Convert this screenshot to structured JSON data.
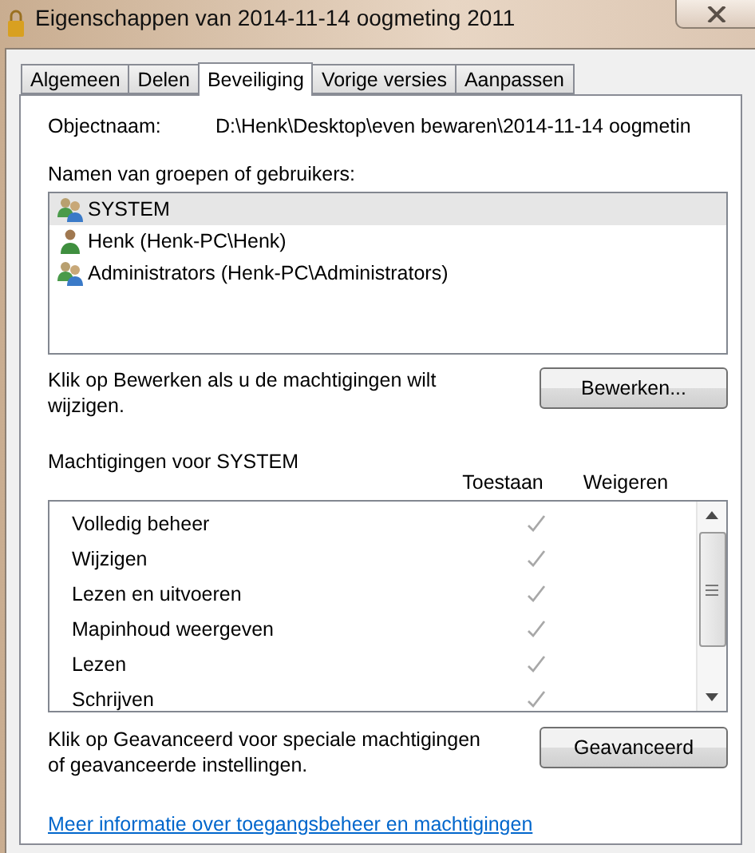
{
  "window": {
    "title": "Eigenschappen van 2014-11-14 oogmeting 2011"
  },
  "tabs": [
    {
      "label": "Algemeen",
      "selected": false
    },
    {
      "label": "Delen",
      "selected": false
    },
    {
      "label": "Beveiliging",
      "selected": true
    },
    {
      "label": "Vorige versies",
      "selected": false
    },
    {
      "label": "Aanpassen",
      "selected": false
    }
  ],
  "object": {
    "label": "Objectnaam:",
    "value": "D:\\Henk\\Desktop\\even bewaren\\2014-11-14 oogmetin"
  },
  "users": {
    "label": "Namen van groepen of gebruikers:",
    "items": [
      {
        "name": "SYSTEM",
        "kind": "group",
        "selected": true
      },
      {
        "name": "Henk (Henk-PC\\Henk)",
        "kind": "user",
        "selected": false
      },
      {
        "name": "Administrators (Henk-PC\\Administrators)",
        "kind": "group",
        "selected": false
      }
    ]
  },
  "edit": {
    "text": "Klik op Bewerken als u de machtigingen wilt wijzigen.",
    "button": "Bewerken..."
  },
  "permissions": {
    "title": "Machtigingen voor SYSTEM",
    "columns": [
      "Toestaan",
      "Weigeren"
    ],
    "rows": [
      {
        "name": "Volledig beheer",
        "allow": true,
        "deny": false
      },
      {
        "name": "Wijzigen",
        "allow": true,
        "deny": false
      },
      {
        "name": "Lezen en uitvoeren",
        "allow": true,
        "deny": false
      },
      {
        "name": "Mapinhoud weergeven",
        "allow": true,
        "deny": false
      },
      {
        "name": "Lezen",
        "allow": true,
        "deny": false
      },
      {
        "name": "Schrijven",
        "allow": true,
        "deny": false
      }
    ]
  },
  "advanced": {
    "text": "Klik op Geavanceerd voor speciale machtigingen of geavanceerde instellingen.",
    "button": "Geavanceerd"
  },
  "link": "Meer informatie over toegangsbeheer en machtigingen"
}
